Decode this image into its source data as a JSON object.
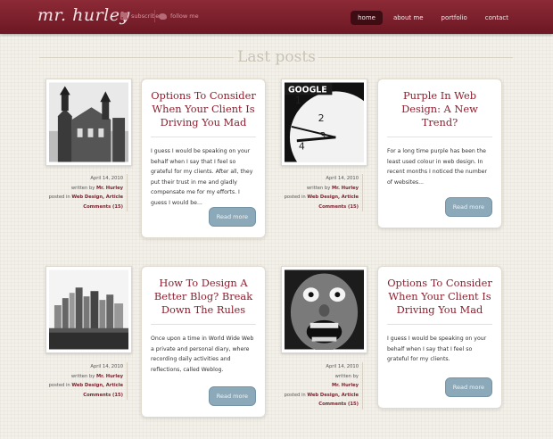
{
  "site": {
    "logo": "mr. hurley",
    "subscribe": "subscribe",
    "follow": "follow me",
    "nav": [
      "home",
      "about me",
      "portfolio",
      "contact"
    ]
  },
  "section_title": "Last posts",
  "colors": {
    "header": "#7d2030",
    "title": "#8d1f2e",
    "button": "#8ba9b9"
  },
  "posts": [
    {
      "title": "Options To Consider When Your Client Is Driving You Mad",
      "excerpt": "I guess I would be speaking on your behalf when I say that I feel so grateful for my clients. After all, they put their trust in me and gladly compensate me for my efforts. I guess I would be...",
      "date": "April 14, 2010",
      "written_by_label": "written by",
      "author": "Mr. Hurley",
      "posted_in_label": "posted in",
      "categories": "Web Design, Article",
      "comments": "Comments (15)",
      "read_more": "Read more",
      "image": "building-icon"
    },
    {
      "title": "Purple In Web Design: A New Trend?",
      "excerpt": "For a long time purple has been the least used colour in web design. In recent months I noticed the number of websites...",
      "date": "April 14, 2010",
      "written_by_label": "written by",
      "author": "Mr. Hurley",
      "posted_in_label": "posted in",
      "categories": "Web Design, Article",
      "comments": "Comments (15)",
      "read_more": "Read more",
      "image": "clock-icon",
      "image_text": "GOOGLE"
    },
    {
      "title": "How To Design A Better Blog? Break Down The Rules",
      "excerpt": "Once upon a time in World Wide Web a private and personal diary, where recording daily activities and reflections, called Weblog.",
      "date": "April 14, 2010",
      "written_by_label": "written by",
      "author": "Mr. Hurley",
      "posted_in_label": "posted in",
      "categories": "Web Design, Article",
      "comments": "Comments (15)",
      "read_more": "Read more",
      "image": "city-skyline-icon"
    },
    {
      "title": "Options To Consider When Your Client Is Driving You Mad",
      "excerpt": "I guess I would be speaking on your behalf when I say that I feel so grateful for my clients.",
      "date": "April 14, 2010",
      "written_by_label": "written by",
      "author": "Mr. Hurley",
      "posted_in_label": "posted in",
      "categories": "Web Design, Article",
      "comments": "Comments (15)",
      "read_more": "Read more",
      "image": "screaming-face-icon"
    }
  ]
}
